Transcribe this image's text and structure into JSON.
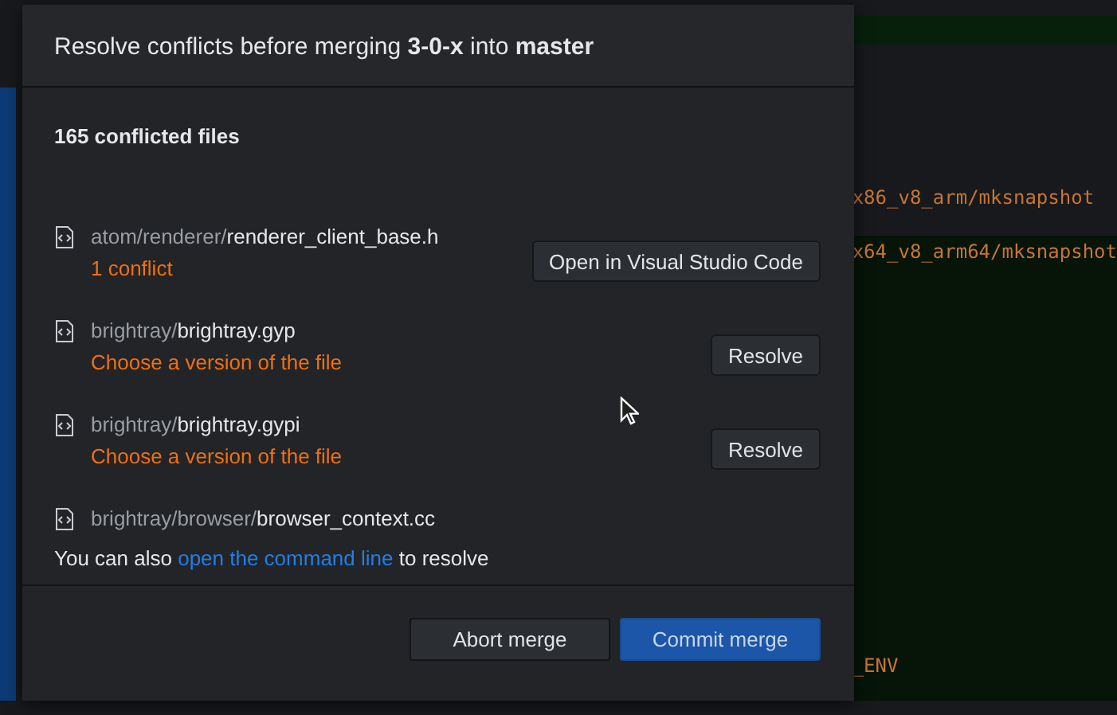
{
  "background_code": [
    {
      "text": "x86_v8_arm/mksnapshot"
    },
    {
      "text": "x64_v8_arm64/mksnapshot"
    },
    {
      "text": "_ENV"
    }
  ],
  "dialog": {
    "title": "Resolve conflicts before merging **3-0-x** into **master**",
    "conflict_count": "165 conflicted files",
    "files": [
      {
        "directory": "atom/renderer/",
        "name": "renderer_client_base.h",
        "status": "1 conflict",
        "action": "Open in Visual Studio Code"
      },
      {
        "directory": "brightray/",
        "name": "brightray.gyp",
        "status": "Choose a version of the file",
        "action": "Resolve"
      },
      {
        "directory": "brightray/",
        "name": "brightray.gypi",
        "status": "Choose a version of the file",
        "action": "Resolve"
      },
      {
        "directory": "brightray/browser/",
        "name": "browser_context.cc"
      }
    ],
    "hint": {
      "before": "You can also",
      "link": "open the command line",
      "after": "to resolve"
    },
    "buttons": [
      {
        "label": "Abort merge",
        "kind": "secondary"
      },
      {
        "label": "Commit merge",
        "kind": "primary"
      }
    ]
  }
}
